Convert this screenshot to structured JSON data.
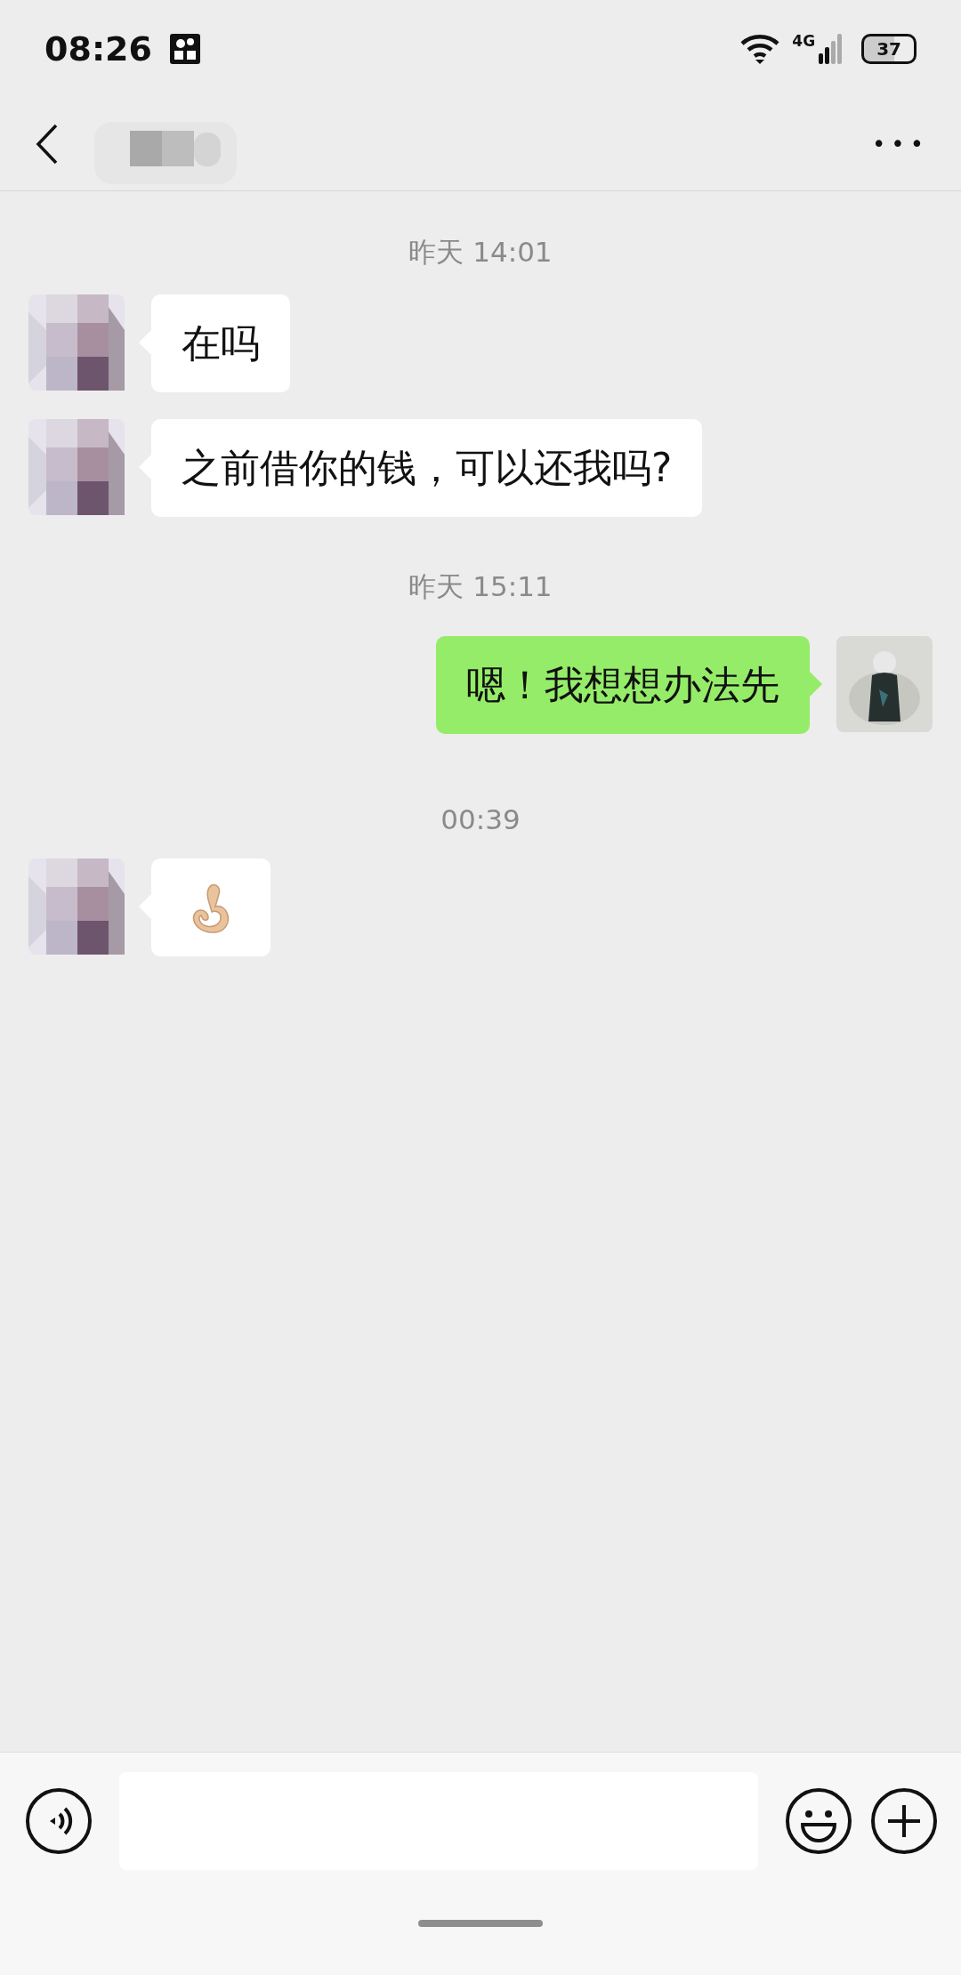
{
  "status_bar": {
    "time": "08:26",
    "network": "4G",
    "battery": "37"
  },
  "header": {
    "more": "•••"
  },
  "messages": [
    {
      "kind": "time",
      "text": "昨天 14:01"
    },
    {
      "kind": "text",
      "mine": false,
      "text": "在吗"
    },
    {
      "kind": "text",
      "mine": false,
      "text": "之前借你的钱，可以还我吗?"
    },
    {
      "kind": "time",
      "text": "昨天 15:11"
    },
    {
      "kind": "text",
      "mine": true,
      "text": "嗯！我想想办法先"
    },
    {
      "kind": "time",
      "text": "00:39"
    },
    {
      "kind": "emoji",
      "mine": false
    }
  ]
}
